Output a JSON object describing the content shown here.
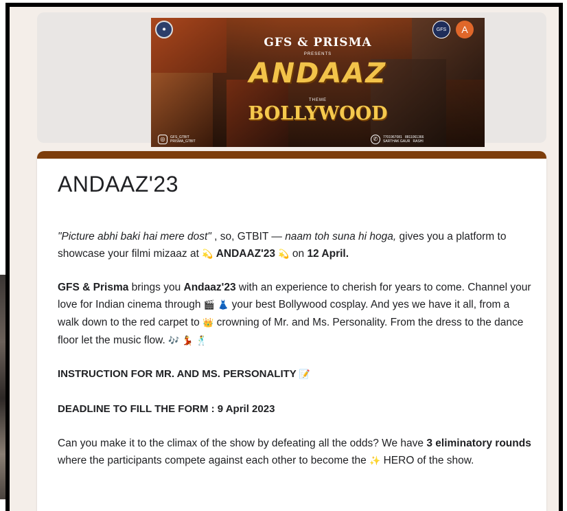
{
  "banner": {
    "brand": "GFS & PRISMA",
    "presents": "PRESENTS",
    "title": "ANDAAZ",
    "theme": "THEME",
    "theme_name": "BOLLYWOOD",
    "logo_left": "✹",
    "logo_gfs": "GFS",
    "logo_a": "A",
    "instagram_icon": "instagram-icon",
    "instagram_handles": [
      "GFS_GTBIT",
      "PRISMA_GTBIT"
    ],
    "phone_icon": "phone-icon",
    "contacts": [
      "7701967081   8811061366",
      "SARTHAK GAUR   RASHI"
    ]
  },
  "form": {
    "accent_color": "#7d3d0b",
    "title": "ANDAAZ'23",
    "p1": {
      "quote": "\"Picture abhi baki hai mere dost\"",
      "t1": " , so, GTBIT — ",
      "italic1": "naam toh suna hi hoga,",
      "t2": " gives you a platform to showcase your filmi mizaaz at ",
      "emoji1": "💫",
      "event": "ANDAAZ'23",
      "emoji2": "💫",
      "t3": "on ",
      "date": "12 April."
    },
    "p2": {
      "org": "GFS & Prisma",
      "t1": " brings you ",
      "event": "Andaaz'23",
      "t2": " with an experience to cherish for years to come. Channel your love for Indian cinema through ",
      "emoji1": "🎬 👗",
      "t3": " your best Bollywood cosplay. And yes we have it all, from a walk down to the red carpet to ",
      "emoji2": "👑",
      "t4": " crowning of Mr. and Ms. Personality. From the dress to the dance floor let the music flow. ",
      "emoji3": "🎶 💃 🕺"
    },
    "instruction": "INSTRUCTION FOR MR. AND MS. PERSONALITY",
    "instruction_emoji": "📝",
    "deadline": "DEADLINE TO FILL THE FORM : 9 April 2023",
    "p3": {
      "t1": "Can you make it to the climax of the show by defeating all the odds? We have ",
      "rounds": "3 eliminatory rounds",
      "t2": " where the participants compete against each other to become the ",
      "emoji": "✨",
      "t3": "HERO of the show."
    }
  }
}
